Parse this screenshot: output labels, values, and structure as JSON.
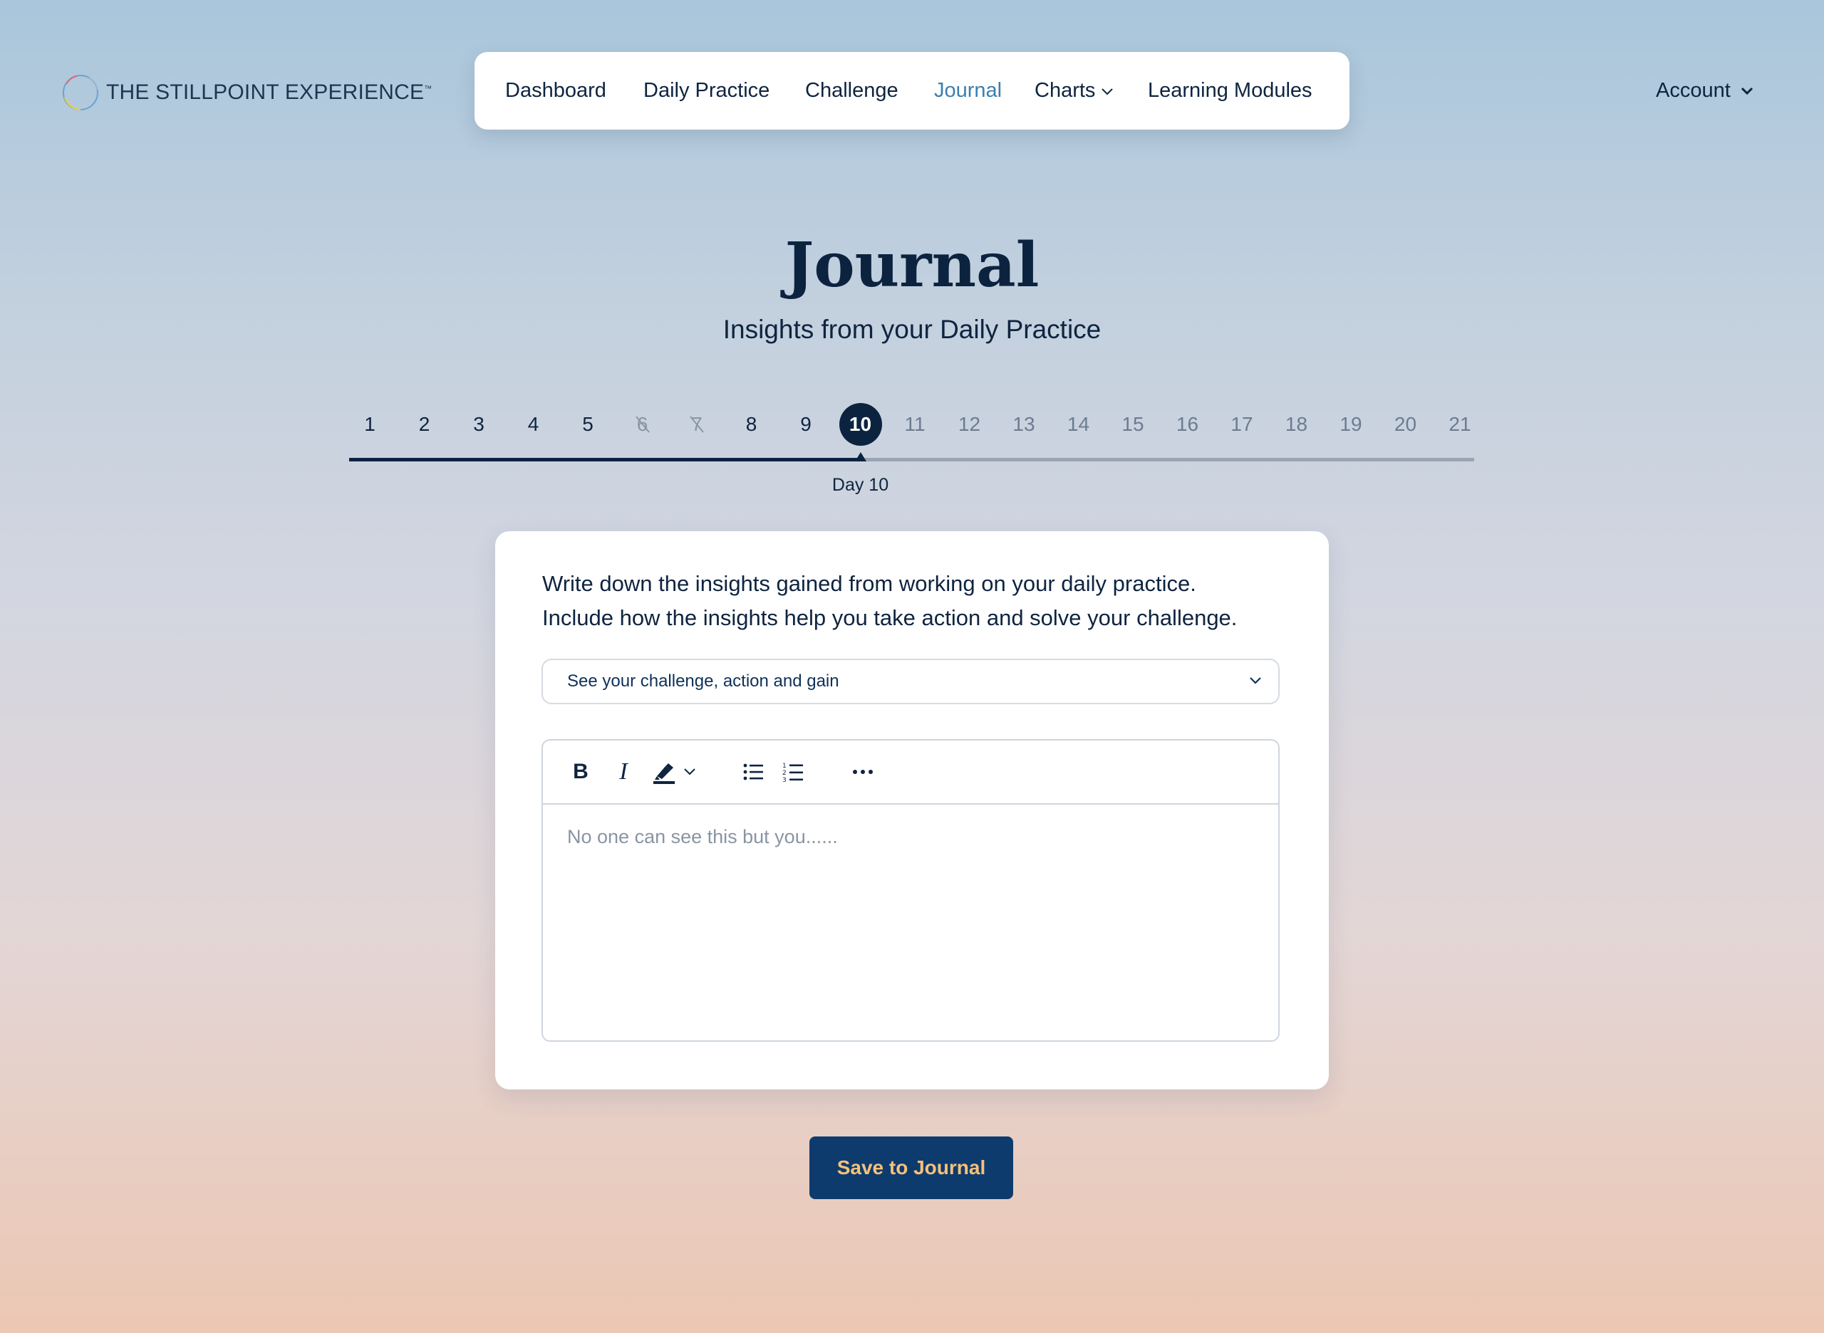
{
  "brand": {
    "name": "THE STILLPOINT EXPERIENCE",
    "tm": "™"
  },
  "nav": {
    "items": [
      {
        "label": "Dashboard",
        "active": false
      },
      {
        "label": "Daily Practice",
        "active": false
      },
      {
        "label": "Challenge",
        "active": false
      },
      {
        "label": "Journal",
        "active": true
      },
      {
        "label": "Charts",
        "active": false,
        "has_dropdown": true
      },
      {
        "label": "Learning Modules",
        "active": false
      }
    ],
    "active_color": "#3b7fae"
  },
  "account": {
    "label": "Account"
  },
  "page": {
    "title": "Journal",
    "subtitle": "Insights from your Daily Practice"
  },
  "days": {
    "items": [
      "1",
      "2",
      "3",
      "4",
      "5",
      "6",
      "7",
      "8",
      "9",
      "10",
      "11",
      "12",
      "13",
      "14",
      "15",
      "16",
      "17",
      "18",
      "19",
      "20",
      "21"
    ],
    "missed": [
      "6",
      "7"
    ],
    "current": "10",
    "current_label": "Day 10"
  },
  "card": {
    "instructions_line1": "Write down the insights gained from working on your daily practice.",
    "instructions_line2": "Include how the insights help you take action and solve your challenge.",
    "dropdown_label": "See your challenge, action and gain",
    "editor_placeholder": "No one can see this but you......",
    "toolbar": {
      "bold": "B",
      "italic": "I",
      "icons": [
        "bold-icon",
        "italic-icon",
        "highlight-icon",
        "bullet-list-icon",
        "numbered-list-icon",
        "more-icon"
      ]
    }
  },
  "actions": {
    "save_label": "Save to Journal"
  },
  "colors": {
    "primary": "#0c2340",
    "button_bg": "#0e3b6e",
    "button_text": "#f4c27a"
  }
}
